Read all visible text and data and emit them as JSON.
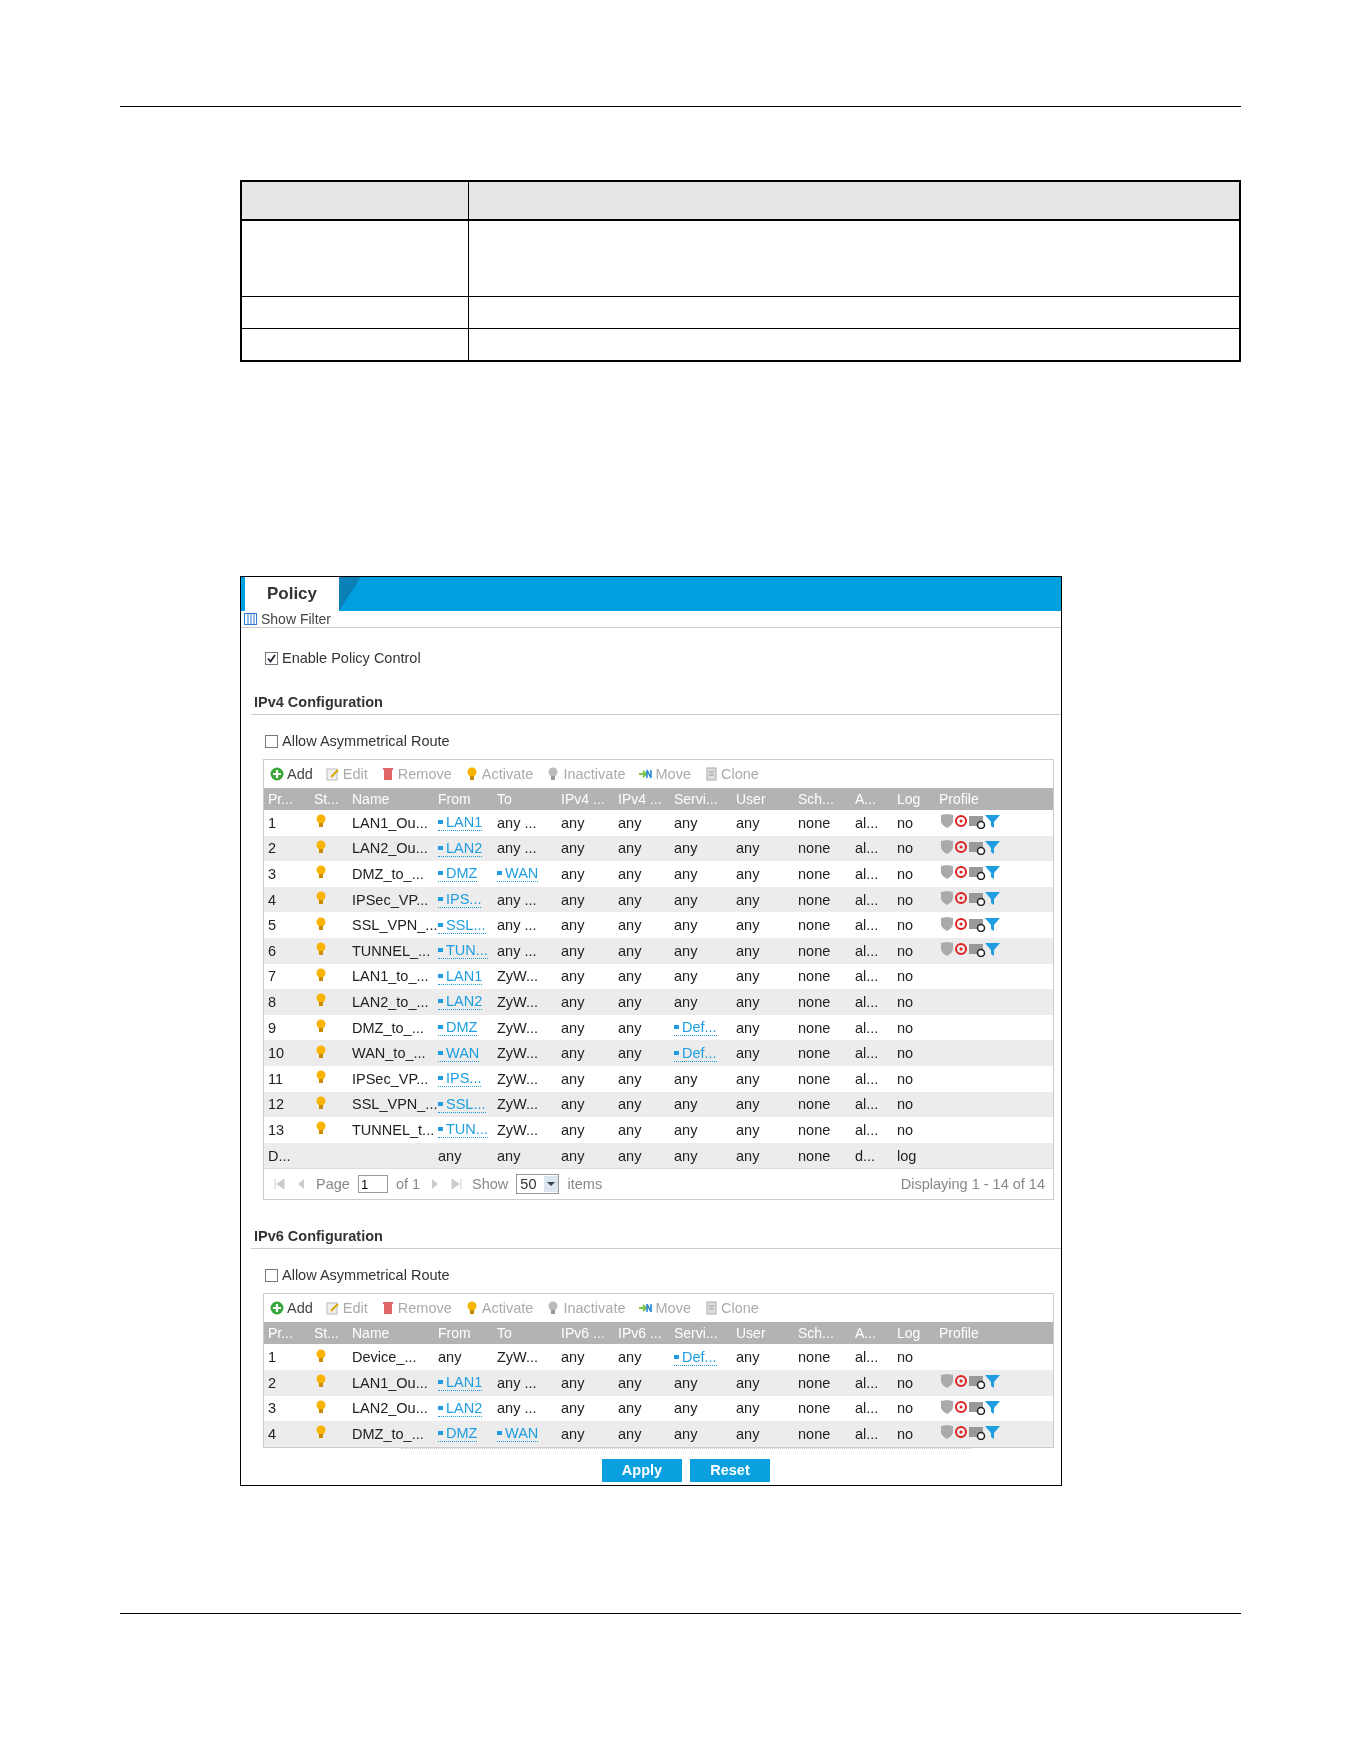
{
  "window": {
    "tabs": [
      {
        "label": "Policy",
        "selected": true
      }
    ],
    "filter_link": "Show Filter"
  },
  "enable": {
    "label": "Enable Policy Control",
    "checked": true
  },
  "sections": [
    {
      "title": "IPv4 Configuration",
      "asym": {
        "label": "Allow Asymmetrical Route",
        "checked": false
      },
      "toolbar": [
        {
          "kind": "add",
          "label": "Add",
          "disabled": false
        },
        {
          "kind": "edit",
          "label": "Edit",
          "disabled": true
        },
        {
          "kind": "remove",
          "label": "Remove",
          "disabled": true
        },
        {
          "kind": "activate",
          "label": "Activate",
          "disabled": true
        },
        {
          "kind": "inactivate",
          "label": "Inactivate",
          "disabled": true
        },
        {
          "kind": "move",
          "label": "Move",
          "disabled": true
        },
        {
          "kind": "clone",
          "label": "Clone",
          "disabled": true
        }
      ],
      "columns": [
        "Pr...",
        "St...",
        "Name",
        "From",
        "To",
        "IPv4 ...",
        "IPv4 ...",
        "Servi...",
        "User",
        "Sch...",
        "A...",
        "Log",
        "Profile"
      ],
      "rows": [
        {
          "cells": [
            {
              "kind": "text",
              "text": "1"
            },
            {
              "kind": "status",
              "active": true
            },
            {
              "kind": "text",
              "text": "LAN1_Ou..."
            },
            {
              "kind": "link",
              "text": "LAN1"
            },
            {
              "kind": "text",
              "text": "any ..."
            },
            {
              "kind": "text",
              "text": "any"
            },
            {
              "kind": "text",
              "text": "any"
            },
            {
              "kind": "text",
              "text": "any"
            },
            {
              "kind": "text",
              "text": "any"
            },
            {
              "kind": "text",
              "text": "none"
            },
            {
              "kind": "text",
              "text": "al..."
            },
            {
              "kind": "text",
              "text": "no"
            },
            {
              "kind": "profiles"
            }
          ]
        },
        {
          "cells": [
            {
              "kind": "text",
              "text": "2"
            },
            {
              "kind": "status",
              "active": true
            },
            {
              "kind": "text",
              "text": "LAN2_Ou..."
            },
            {
              "kind": "link",
              "text": "LAN2"
            },
            {
              "kind": "text",
              "text": "any ..."
            },
            {
              "kind": "text",
              "text": "any"
            },
            {
              "kind": "text",
              "text": "any"
            },
            {
              "kind": "text",
              "text": "any"
            },
            {
              "kind": "text",
              "text": "any"
            },
            {
              "kind": "text",
              "text": "none"
            },
            {
              "kind": "text",
              "text": "al..."
            },
            {
              "kind": "text",
              "text": "no"
            },
            {
              "kind": "profiles"
            }
          ]
        },
        {
          "cells": [
            {
              "kind": "text",
              "text": "3"
            },
            {
              "kind": "status",
              "active": true
            },
            {
              "kind": "text",
              "text": "DMZ_to_..."
            },
            {
              "kind": "link",
              "text": "DMZ"
            },
            {
              "kind": "link",
              "text": "WAN"
            },
            {
              "kind": "text",
              "text": "any"
            },
            {
              "kind": "text",
              "text": "any"
            },
            {
              "kind": "text",
              "text": "any"
            },
            {
              "kind": "text",
              "text": "any"
            },
            {
              "kind": "text",
              "text": "none"
            },
            {
              "kind": "text",
              "text": "al..."
            },
            {
              "kind": "text",
              "text": "no"
            },
            {
              "kind": "profiles"
            }
          ]
        },
        {
          "cells": [
            {
              "kind": "text",
              "text": "4"
            },
            {
              "kind": "status",
              "active": true
            },
            {
              "kind": "text",
              "text": "IPSec_VP..."
            },
            {
              "kind": "link",
              "text": "IPS..."
            },
            {
              "kind": "text",
              "text": "any ..."
            },
            {
              "kind": "text",
              "text": "any"
            },
            {
              "kind": "text",
              "text": "any"
            },
            {
              "kind": "text",
              "text": "any"
            },
            {
              "kind": "text",
              "text": "any"
            },
            {
              "kind": "text",
              "text": "none"
            },
            {
              "kind": "text",
              "text": "al..."
            },
            {
              "kind": "text",
              "text": "no"
            },
            {
              "kind": "profiles"
            }
          ]
        },
        {
          "cells": [
            {
              "kind": "text",
              "text": "5"
            },
            {
              "kind": "status",
              "active": true
            },
            {
              "kind": "text",
              "text": "SSL_VPN_..."
            },
            {
              "kind": "link",
              "text": "SSL..."
            },
            {
              "kind": "text",
              "text": "any ..."
            },
            {
              "kind": "text",
              "text": "any"
            },
            {
              "kind": "text",
              "text": "any"
            },
            {
              "kind": "text",
              "text": "any"
            },
            {
              "kind": "text",
              "text": "any"
            },
            {
              "kind": "text",
              "text": "none"
            },
            {
              "kind": "text",
              "text": "al..."
            },
            {
              "kind": "text",
              "text": "no"
            },
            {
              "kind": "profiles"
            }
          ]
        },
        {
          "cells": [
            {
              "kind": "text",
              "text": "6"
            },
            {
              "kind": "status",
              "active": true
            },
            {
              "kind": "text",
              "text": "TUNNEL_..."
            },
            {
              "kind": "link",
              "text": "TUN..."
            },
            {
              "kind": "text",
              "text": "any ..."
            },
            {
              "kind": "text",
              "text": "any"
            },
            {
              "kind": "text",
              "text": "any"
            },
            {
              "kind": "text",
              "text": "any"
            },
            {
              "kind": "text",
              "text": "any"
            },
            {
              "kind": "text",
              "text": "none"
            },
            {
              "kind": "text",
              "text": "al..."
            },
            {
              "kind": "text",
              "text": "no"
            },
            {
              "kind": "profiles"
            }
          ]
        },
        {
          "cells": [
            {
              "kind": "text",
              "text": "7"
            },
            {
              "kind": "status",
              "active": true
            },
            {
              "kind": "text",
              "text": "LAN1_to_..."
            },
            {
              "kind": "link",
              "text": "LAN1"
            },
            {
              "kind": "text",
              "text": "ZyW..."
            },
            {
              "kind": "text",
              "text": "any"
            },
            {
              "kind": "text",
              "text": "any"
            },
            {
              "kind": "text",
              "text": "any"
            },
            {
              "kind": "text",
              "text": "any"
            },
            {
              "kind": "text",
              "text": "none"
            },
            {
              "kind": "text",
              "text": "al..."
            },
            {
              "kind": "text",
              "text": "no"
            }
          ]
        },
        {
          "cells": [
            {
              "kind": "text",
              "text": "8"
            },
            {
              "kind": "status",
              "active": true
            },
            {
              "kind": "text",
              "text": "LAN2_to_..."
            },
            {
              "kind": "link",
              "text": "LAN2"
            },
            {
              "kind": "text",
              "text": "ZyW..."
            },
            {
              "kind": "text",
              "text": "any"
            },
            {
              "kind": "text",
              "text": "any"
            },
            {
              "kind": "text",
              "text": "any"
            },
            {
              "kind": "text",
              "text": "any"
            },
            {
              "kind": "text",
              "text": "none"
            },
            {
              "kind": "text",
              "text": "al..."
            },
            {
              "kind": "text",
              "text": "no"
            }
          ]
        },
        {
          "cells": [
            {
              "kind": "text",
              "text": "9"
            },
            {
              "kind": "status",
              "active": true
            },
            {
              "kind": "text",
              "text": "DMZ_to_..."
            },
            {
              "kind": "link",
              "text": "DMZ"
            },
            {
              "kind": "text",
              "text": "ZyW..."
            },
            {
              "kind": "text",
              "text": "any"
            },
            {
              "kind": "text",
              "text": "any"
            },
            {
              "kind": "link",
              "text": "Def..."
            },
            {
              "kind": "text",
              "text": "any"
            },
            {
              "kind": "text",
              "text": "none"
            },
            {
              "kind": "text",
              "text": "al..."
            },
            {
              "kind": "text",
              "text": "no"
            }
          ]
        },
        {
          "cells": [
            {
              "kind": "text",
              "text": "10"
            },
            {
              "kind": "status",
              "active": true
            },
            {
              "kind": "text",
              "text": "WAN_to_..."
            },
            {
              "kind": "link",
              "text": "WAN"
            },
            {
              "kind": "text",
              "text": "ZyW..."
            },
            {
              "kind": "text",
              "text": "any"
            },
            {
              "kind": "text",
              "text": "any"
            },
            {
              "kind": "link",
              "text": "Def..."
            },
            {
              "kind": "text",
              "text": "any"
            },
            {
              "kind": "text",
              "text": "none"
            },
            {
              "kind": "text",
              "text": "al..."
            },
            {
              "kind": "text",
              "text": "no"
            }
          ]
        },
        {
          "cells": [
            {
              "kind": "text",
              "text": "11"
            },
            {
              "kind": "status",
              "active": true
            },
            {
              "kind": "text",
              "text": "IPSec_VP..."
            },
            {
              "kind": "link",
              "text": "IPS..."
            },
            {
              "kind": "text",
              "text": "ZyW..."
            },
            {
              "kind": "text",
              "text": "any"
            },
            {
              "kind": "text",
              "text": "any"
            },
            {
              "kind": "text",
              "text": "any"
            },
            {
              "kind": "text",
              "text": "any"
            },
            {
              "kind": "text",
              "text": "none"
            },
            {
              "kind": "text",
              "text": "al..."
            },
            {
              "kind": "text",
              "text": "no"
            }
          ]
        },
        {
          "cells": [
            {
              "kind": "text",
              "text": "12"
            },
            {
              "kind": "status",
              "active": true
            },
            {
              "kind": "text",
              "text": "SSL_VPN_..."
            },
            {
              "kind": "link",
              "text": "SSL..."
            },
            {
              "kind": "text",
              "text": "ZyW..."
            },
            {
              "kind": "text",
              "text": "any"
            },
            {
              "kind": "text",
              "text": "any"
            },
            {
              "kind": "text",
              "text": "any"
            },
            {
              "kind": "text",
              "text": "any"
            },
            {
              "kind": "text",
              "text": "none"
            },
            {
              "kind": "text",
              "text": "al..."
            },
            {
              "kind": "text",
              "text": "no"
            }
          ]
        },
        {
          "cells": [
            {
              "kind": "text",
              "text": "13"
            },
            {
              "kind": "status",
              "active": true
            },
            {
              "kind": "text",
              "text": "TUNNEL_t..."
            },
            {
              "kind": "link",
              "text": "TUN..."
            },
            {
              "kind": "text",
              "text": "ZyW..."
            },
            {
              "kind": "text",
              "text": "any"
            },
            {
              "kind": "text",
              "text": "any"
            },
            {
              "kind": "text",
              "text": "any"
            },
            {
              "kind": "text",
              "text": "any"
            },
            {
              "kind": "text",
              "text": "none"
            },
            {
              "kind": "text",
              "text": "al..."
            },
            {
              "kind": "text",
              "text": "no"
            }
          ]
        },
        {
          "cells": [
            {
              "kind": "text",
              "text": "D..."
            },
            {
              "kind": "blank"
            },
            {
              "kind": "blank"
            },
            {
              "kind": "text",
              "text": "any"
            },
            {
              "kind": "text",
              "text": "any"
            },
            {
              "kind": "text",
              "text": "any"
            },
            {
              "kind": "text",
              "text": "any"
            },
            {
              "kind": "text",
              "text": "any"
            },
            {
              "kind": "text",
              "text": "any"
            },
            {
              "kind": "text",
              "text": "none"
            },
            {
              "kind": "text",
              "text": "d..."
            },
            {
              "kind": "text",
              "text": "log"
            }
          ]
        }
      ],
      "pager": {
        "page_label": "Page",
        "page": "1",
        "of": "of 1",
        "show_label": "Show",
        "per_page": "50",
        "items_label": "items",
        "summary": "Displaying 1 - 14 of 14"
      }
    },
    {
      "title": "IPv6 Configuration",
      "asym": {
        "label": "Allow Asymmetrical Route",
        "checked": false
      },
      "toolbar": [
        {
          "kind": "add",
          "label": "Add",
          "disabled": false
        },
        {
          "kind": "edit",
          "label": "Edit",
          "disabled": true
        },
        {
          "kind": "remove",
          "label": "Remove",
          "disabled": true
        },
        {
          "kind": "activate",
          "label": "Activate",
          "disabled": true
        },
        {
          "kind": "inactivate",
          "label": "Inactivate",
          "disabled": true
        },
        {
          "kind": "move",
          "label": "Move",
          "disabled": true
        },
        {
          "kind": "clone",
          "label": "Clone",
          "disabled": true
        }
      ],
      "columns": [
        "Pr...",
        "St...",
        "Name",
        "From",
        "To",
        "IPv6 ...",
        "IPv6 ...",
        "Servi...",
        "User",
        "Sch...",
        "A...",
        "Log",
        "Profile"
      ],
      "rows": [
        {
          "cells": [
            {
              "kind": "text",
              "text": "1"
            },
            {
              "kind": "status",
              "active": true
            },
            {
              "kind": "text",
              "text": "Device_..."
            },
            {
              "kind": "text",
              "text": "any"
            },
            {
              "kind": "text",
              "text": "ZyW..."
            },
            {
              "kind": "text",
              "text": "any"
            },
            {
              "kind": "text",
              "text": "any"
            },
            {
              "kind": "link",
              "text": "Def..."
            },
            {
              "kind": "text",
              "text": "any"
            },
            {
              "kind": "text",
              "text": "none"
            },
            {
              "kind": "text",
              "text": "al..."
            },
            {
              "kind": "text",
              "text": "no"
            }
          ]
        },
        {
          "cells": [
            {
              "kind": "text",
              "text": "2"
            },
            {
              "kind": "status",
              "active": true
            },
            {
              "kind": "text",
              "text": "LAN1_Ou..."
            },
            {
              "kind": "link",
              "text": "LAN1"
            },
            {
              "kind": "text",
              "text": "any ..."
            },
            {
              "kind": "text",
              "text": "any"
            },
            {
              "kind": "text",
              "text": "any"
            },
            {
              "kind": "text",
              "text": "any"
            },
            {
              "kind": "text",
              "text": "any"
            },
            {
              "kind": "text",
              "text": "none"
            },
            {
              "kind": "text",
              "text": "al..."
            },
            {
              "kind": "text",
              "text": "no"
            },
            {
              "kind": "profiles"
            }
          ]
        },
        {
          "cells": [
            {
              "kind": "text",
              "text": "3"
            },
            {
              "kind": "status",
              "active": true
            },
            {
              "kind": "text",
              "text": "LAN2_Ou..."
            },
            {
              "kind": "link",
              "text": "LAN2"
            },
            {
              "kind": "text",
              "text": "any ..."
            },
            {
              "kind": "text",
              "text": "any"
            },
            {
              "kind": "text",
              "text": "any"
            },
            {
              "kind": "text",
              "text": "any"
            },
            {
              "kind": "text",
              "text": "any"
            },
            {
              "kind": "text",
              "text": "none"
            },
            {
              "kind": "text",
              "text": "al..."
            },
            {
              "kind": "text",
              "text": "no"
            },
            {
              "kind": "profiles"
            }
          ]
        },
        {
          "cells": [
            {
              "kind": "text",
              "text": "4"
            },
            {
              "kind": "status",
              "active": true
            },
            {
              "kind": "text",
              "text": "DMZ_to_..."
            },
            {
              "kind": "link",
              "text": "DMZ"
            },
            {
              "kind": "link",
              "text": "WAN"
            },
            {
              "kind": "text",
              "text": "any"
            },
            {
              "kind": "text",
              "text": "any"
            },
            {
              "kind": "text",
              "text": "any"
            },
            {
              "kind": "text",
              "text": "any"
            },
            {
              "kind": "text",
              "text": "none"
            },
            {
              "kind": "text",
              "text": "al..."
            },
            {
              "kind": "text",
              "text": "no"
            },
            {
              "kind": "profiles"
            }
          ]
        }
      ]
    }
  ],
  "buttons": [
    {
      "label": "Apply"
    },
    {
      "label": "Reset"
    }
  ]
}
